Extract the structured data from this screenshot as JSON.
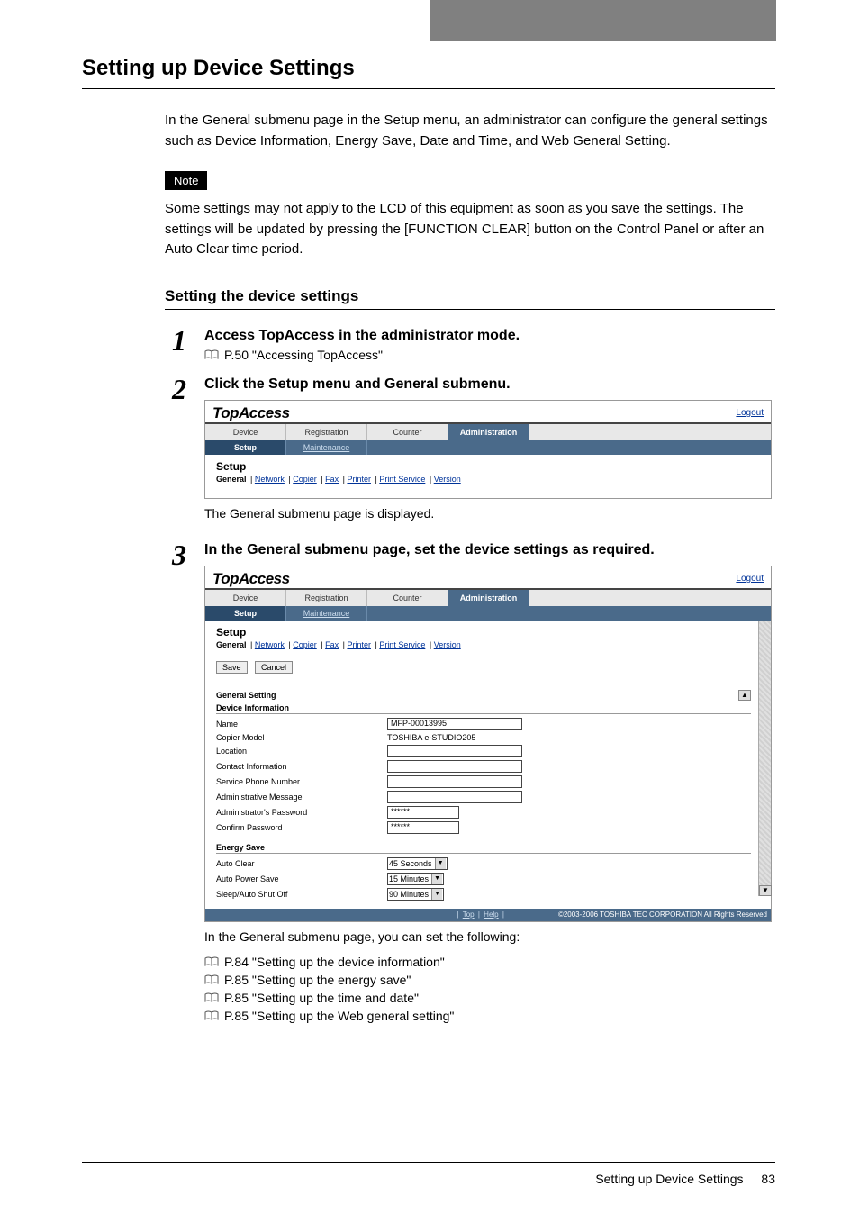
{
  "heading": "Setting up Device Settings",
  "intro": "In the General submenu page in the Setup menu, an administrator can configure the general settings such as Device Information, Energy Save, Date and Time, and Web General Setting.",
  "note_label": "Note",
  "note_text": "Some settings may not apply to the LCD of this equipment as soon as you save the settings. The settings will be updated by pressing the [FUNCTION CLEAR] button on the Control Panel or after an Auto Clear time period.",
  "subheading": "Setting the device settings",
  "steps": {
    "s1": {
      "num": "1",
      "title": "Access TopAccess in the administrator mode.",
      "ref": "P.50 \"Accessing TopAccess\""
    },
    "s2": {
      "num": "2",
      "title": "Click the Setup menu and General submenu.",
      "caption": "The General submenu page is displayed."
    },
    "s3": {
      "num": "3",
      "title": "In the General submenu page, set the device settings as required.",
      "caption": "In the General submenu page, you can set the following:",
      "refs": [
        "P.84 \"Setting up the device information\"",
        "P.85 \"Setting up the energy save\"",
        "P.85 \"Setting up the time and date\"",
        "P.85 \"Setting up the Web general setting\""
      ]
    }
  },
  "topaccess": {
    "logo": "TopAccess",
    "logout": "Logout",
    "main_tabs": [
      "Device",
      "Registration",
      "Counter",
      "Administration"
    ],
    "sub_tabs": [
      "Setup",
      "Maintenance"
    ],
    "setup_title": "Setup",
    "submenu_items": [
      "General",
      "Network",
      "Copier",
      "Fax",
      "Printer",
      "Print Service",
      "Version"
    ],
    "save_btn": "Save",
    "cancel_btn": "Cancel",
    "general_setting_head": "General Setting",
    "device_info_head": "Device Information",
    "fields": {
      "name_label": "Name",
      "name_value": "MFP-00013995",
      "model_label": "Copier Model",
      "model_value": "TOSHIBA e-STUDIO205",
      "location_label": "Location",
      "contact_label": "Contact Information",
      "service_phone_label": "Service Phone Number",
      "admin_msg_label": "Administrative Message",
      "admin_pw_label": "Administrator's Password",
      "admin_pw_value": "******",
      "confirm_pw_label": "Confirm Password",
      "confirm_pw_value": "******"
    },
    "energy_save_head": "Energy Save",
    "energy": {
      "auto_clear_label": "Auto Clear",
      "auto_clear_value": "45 Seconds",
      "auto_power_save_label": "Auto Power Save",
      "auto_power_save_value": "15 Minutes",
      "sleep_label": "Sleep/Auto Shut Off",
      "sleep_value": "90 Minutes"
    },
    "footer_links": [
      "Top",
      "Help"
    ],
    "copyright": "©2003-2006 TOSHIBA TEC CORPORATION All Rights Reserved"
  },
  "footer": {
    "title": "Setting up Device Settings",
    "page": "83"
  }
}
